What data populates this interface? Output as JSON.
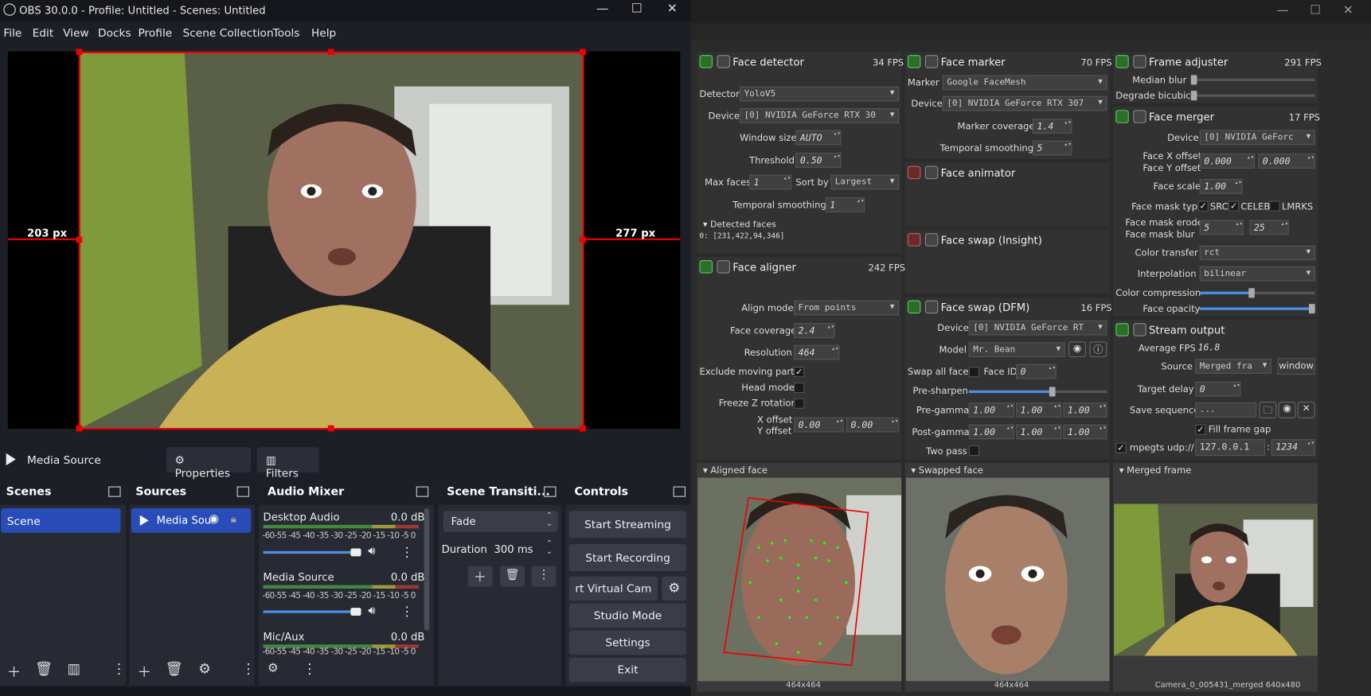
{
  "obs": {
    "title": "OBS 30.0.0 - Profile: Untitled - Scenes: Untitled",
    "menu": [
      "File",
      "Edit",
      "View",
      "Docks",
      "Profile",
      "Scene Collection",
      "Tools",
      "Help"
    ],
    "preview": {
      "left_px": "203 px",
      "right_px": "277 px"
    },
    "source_bar": {
      "source": "Media Source",
      "properties": "Properties",
      "filters": "Filters"
    },
    "scenes": {
      "title": "Scenes",
      "items": [
        "Scene"
      ]
    },
    "sources": {
      "title": "Sources",
      "items": [
        "Media Sou"
      ]
    },
    "mixer": {
      "title": "Audio Mixer",
      "channels": [
        {
          "name": "Desktop Audio",
          "db": "0.0 dB",
          "level": 0.85
        },
        {
          "name": "Media Source",
          "db": "0.0 dB",
          "level": 0.85
        },
        {
          "name": "Mic/Aux",
          "db": "0.0 dB",
          "level": 0.85
        }
      ],
      "scale": "-60-55 -45 -40 -35 -30 -25 -20 -15 -10 -5  0"
    },
    "transitions": {
      "title": "Scene Transiti...",
      "type": "Fade",
      "duration_label": "Duration",
      "duration": "300 ms"
    },
    "controls": {
      "title": "Controls",
      "start_streaming": "Start Streaming",
      "start_recording": "Start Recording",
      "virtual_cam": "rt Virtual Cam",
      "studio_mode": "Studio Mode",
      "settings": "Settings",
      "exit": "Exit"
    }
  },
  "dfl": {
    "face_detector": {
      "title": "Face detector",
      "fps": "34 FPS",
      "detector_label": "Detector",
      "detector": "YoloV5",
      "device_label": "Device",
      "device": "[0] NVIDIA GeForce RTX 30",
      "window_size_label": "Window size",
      "window_size": "AUTO",
      "threshold_label": "Threshold",
      "threshold": "0.50",
      "max_faces_label": "Max faces",
      "max_faces": "1",
      "sort_by_label": "Sort by",
      "sort_by": "Largest",
      "temporal_label": "Temporal smoothing",
      "temporal": "1",
      "detected_label": "Detected faces",
      "detected_value": "0: [231,422,94,346]"
    },
    "face_marker": {
      "title": "Face marker",
      "fps": "70 FPS",
      "marker_label": "Marker",
      "marker": "Google FaceMesh",
      "device_label": "Device",
      "device": "[0] NVIDIA GeForce RTX 307",
      "coverage_label": "Marker coverage",
      "coverage": "1.4",
      "temporal_label": "Temporal smoothing",
      "temporal": "5"
    },
    "face_animator": {
      "title": "Face animator"
    },
    "face_swap_insight": {
      "title": "Face swap (Insight)"
    },
    "face_aligner": {
      "title": "Face aligner",
      "fps": "242 FPS",
      "align_label": "Align mode",
      "align": "From points",
      "coverage_label": "Face coverage",
      "coverage": "2.4",
      "resolution_label": "Resolution",
      "resolution": "464",
      "exclude_label": "Exclude moving parts",
      "head_label": "Head mode",
      "freeze_label": "Freeze Z rotation",
      "xoff_label": "X offset",
      "yoff_label": "Y offset",
      "xoff": "0.00",
      "yoff": "0.00"
    },
    "face_swap_dfm": {
      "title": "Face swap (DFM)",
      "fps": "16 FPS",
      "device_label": "Device",
      "device": "[0] NVIDIA GeForce RT",
      "model_label": "Model",
      "model": "Mr. Bean",
      "swap_all_label": "Swap all faces",
      "face_id_label": "Face ID",
      "face_id": "0",
      "presharpen_label": "Pre-sharpen",
      "presharpen": 0.6,
      "pregamma_label": "Pre-gamma",
      "postgamma_label": "Post-gamma",
      "gamma": "1.00",
      "two_pass_label": "Two pass"
    },
    "frame_adjuster": {
      "title": "Frame adjuster",
      "fps": "291 FPS",
      "median_label": "Median blur",
      "degrade_label": "Degrade bicubic"
    },
    "face_merger": {
      "title": "Face merger",
      "fps": "17 FPS",
      "device_label": "Device",
      "device": "[0] NVIDIA GeForc",
      "xoff_label": "Face X offset",
      "yoff_label": "Face Y offset",
      "xoff": "0.000",
      "yoff": "0.000",
      "scale_label": "Face scale",
      "scale": "1.00",
      "mask_type_label": "Face mask type",
      "src": "SRC",
      "celeb": "CELEB",
      "lmrks": "LMRKS",
      "erode_label": "Face mask erode",
      "blur_label": "Face mask blur",
      "erode": "5",
      "blur": "25",
      "color_transfer_label": "Color transfer",
      "color_transfer": "rct",
      "interp_label": "Interpolation",
      "interp": "bilinear",
      "compression_label": "Color compression",
      "compression": 0.45,
      "opacity_label": "Face opacity",
      "opacity": 1.0
    },
    "stream_output": {
      "title": "Stream output",
      "avg_label": "Average FPS",
      "avg": "16.8",
      "source_label": "Source",
      "source": "Merged fra",
      "window": "window",
      "delay_label": "Target delay",
      "delay": "0",
      "save_label": "Save sequence",
      "save": "...",
      "fill_label": "Fill frame gap",
      "mpegts_label": "mpegts udp://",
      "ip": "127.0.0.1",
      "port": "1234"
    },
    "views": {
      "aligned": "Aligned face",
      "swapped": "Swapped face",
      "merged": "Merged frame",
      "aligned_cap": "464x464",
      "swapped_cap": "464x464",
      "merged_cap": "Camera_0_005431_merged 640x480"
    }
  }
}
